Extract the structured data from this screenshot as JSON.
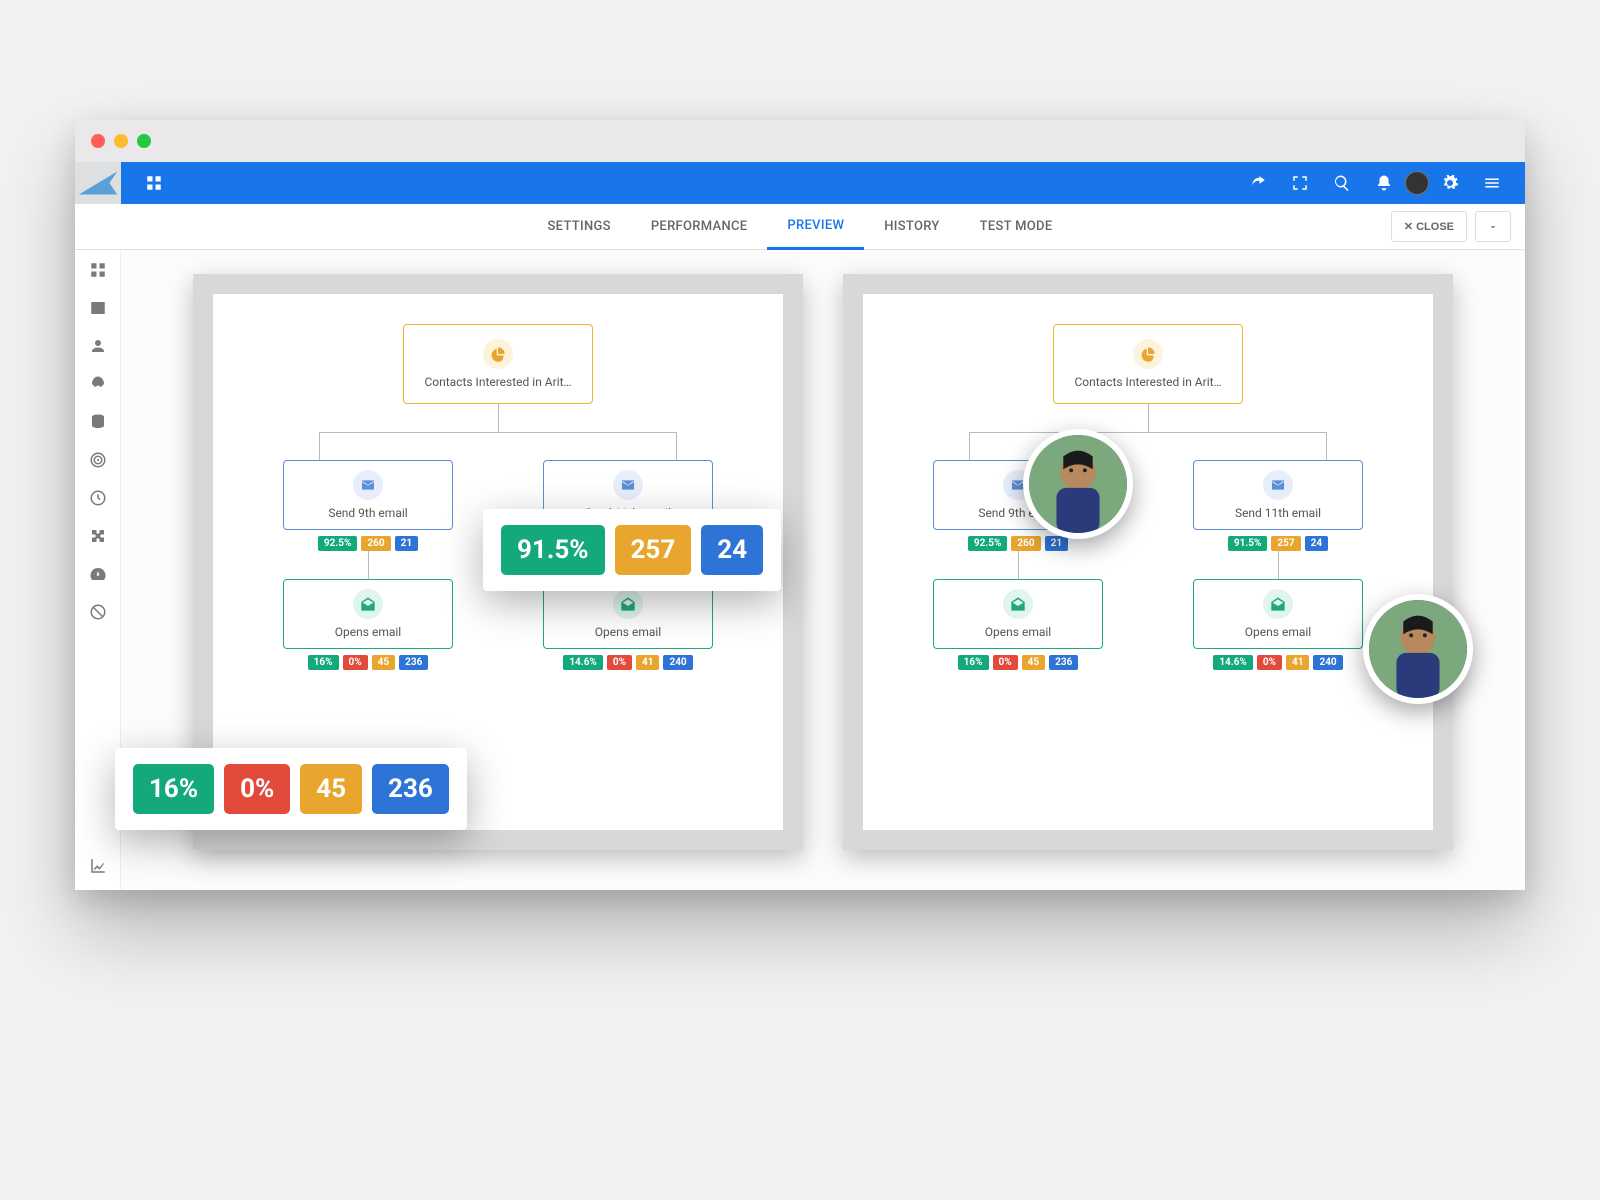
{
  "tabs": {
    "settings": "SETTINGS",
    "performance": "PERFORMANCE",
    "preview": "PREVIEW",
    "history": "HISTORY",
    "test_mode": "TEST MODE"
  },
  "close_label": "CLOSE",
  "flow": {
    "segment_label": "Contacts Interested in Arit…",
    "left": {
      "email_label": "Send 9th email",
      "email_stats": {
        "rate": "92.5%",
        "sent": "260",
        "other": "21"
      },
      "open_label": "Opens email",
      "open_stats": {
        "rate": "16%",
        "fail": "0%",
        "a": "45",
        "b": "236"
      }
    },
    "right": {
      "email_label": "Send 11th email",
      "email_stats": {
        "rate": "91.5%",
        "sent": "257",
        "other": "24"
      },
      "open_label": "Opens email",
      "open_stats": {
        "rate": "14.6%",
        "fail": "0%",
        "a": "41",
        "b": "240"
      }
    }
  },
  "callout_big": {
    "rate": "91.5%",
    "sent": "257",
    "other": "24"
  },
  "callout_small": {
    "rate": "16%",
    "fail": "0%",
    "a": "45",
    "b": "236"
  }
}
